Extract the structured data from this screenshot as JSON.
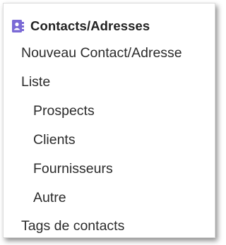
{
  "menu": {
    "header": {
      "title": "Contacts/Adresses",
      "icon": "address-book-icon",
      "icon_color": "#7b6ad6"
    },
    "items": [
      {
        "label": "Nouveau Contact/Adresse",
        "level": 0
      },
      {
        "label": "Liste",
        "level": 0
      },
      {
        "label": "Prospects",
        "level": 1
      },
      {
        "label": "Clients",
        "level": 1
      },
      {
        "label": "Fournisseurs",
        "level": 1
      },
      {
        "label": "Autre",
        "level": 1
      },
      {
        "label": "Tags de contacts",
        "level": 0
      }
    ]
  }
}
